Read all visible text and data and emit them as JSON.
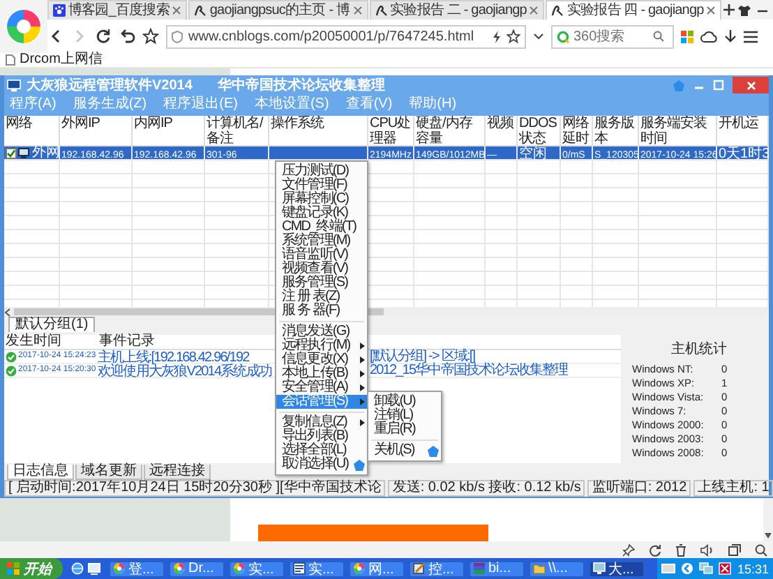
{
  "browser": {
    "tabs": [
      {
        "kind": "paw",
        "label": "博客园_百度搜索",
        "selected": false
      },
      {
        "kind": "blog",
        "label": "gaojiangpsuc的主页 - 博",
        "selected": false
      },
      {
        "kind": "blog",
        "label": "实验报告 二 - gaojiangp",
        "selected": false
      },
      {
        "kind": "blog",
        "label": "实验报告 四 - gaojiangp",
        "selected": true
      }
    ],
    "nav": [
      {
        "kind": "back",
        "disabled": false
      },
      {
        "kind": "forward",
        "disabled": true
      },
      {
        "kind": "reload",
        "disabled": false
      },
      {
        "kind": "undo",
        "disabled": false
      },
      {
        "kind": "star",
        "disabled": false
      }
    ],
    "address": "www.cnblogs.com/p20050001/p/7647245.html",
    "search": {
      "placeholder": "360搜索"
    },
    "bookmarks": [
      "Drcom上网信"
    ]
  },
  "app": {
    "title": "大灰狼远程管理软件V2014",
    "subtitle": "华中帝国技术论坛收集整理",
    "menu": [
      "程序(A)",
      "服务生成(Z)",
      "程序退出(E)",
      "本地设置(S)",
      "查看(V)",
      "帮助(H)"
    ],
    "table": {
      "columns": [
        "网络",
        "外网IP",
        "内网IP",
        "计算机名/备注",
        "操作系统",
        "CPU处理器",
        "硬盘/内存容量",
        "视频",
        "DDOS状态",
        "网络延时",
        "服务版本",
        "服务端安装时间",
        "开机运"
      ],
      "rows": [
        {
          "selected": true,
          "checked": true,
          "cells": [
            "外网",
            "192.168.42.96",
            "192.168.42.96",
            "301-96",
            null,
            "2194MHz",
            "149GB/1012MB",
            "—",
            "空闲",
            "0/mS",
            "S_120305",
            "2017-10-24 15:26",
            "0天1时3"
          ]
        }
      ]
    },
    "group_tabs": [
      {
        "label": "默认分组(1)",
        "selected": true
      }
    ],
    "log": {
      "columns": [
        "发生时间",
        "事件记录"
      ],
      "rows": [
        {
          "kind": "success",
          "time": "2017-10-24 15:24:23",
          "event_start": "主机上线:[192.168.42.96/192",
          "event_end": "[默认分组] -> 区域:[]"
        },
        {
          "kind": "success",
          "time": "2017-10-24 15:20:30",
          "event_start": "欢迎使用大灰狼V2014系统成功",
          "event_end": "2012_15华中帝国技术论坛收集整理"
        }
      ]
    },
    "stats": {
      "title": "主机统计",
      "rows": [
        {
          "label": "Windows NT:",
          "value": "0"
        },
        {
          "label": "Windows XP:",
          "value": "1"
        },
        {
          "label": "Windows Vista:",
          "value": "0"
        },
        {
          "label": "Windows 7:",
          "value": "0"
        },
        {
          "label": "Windows 2000:",
          "value": "0"
        },
        {
          "label": "Windows 2003:",
          "value": "0"
        },
        {
          "label": "Windows 2008:",
          "value": "0"
        }
      ]
    },
    "bottom_tabs": [
      {
        "label": "日志信息",
        "selected": true
      },
      {
        "label": "域名更新",
        "selected": false
      },
      {
        "label": "远程连接",
        "selected": false
      }
    ],
    "status": [
      "[ 启动时间:2017年10月24日 15时20分30秒 ][华中帝国技术论",
      "发送: 0.02 kb/s 接收: 0.12 kb/s",
      "监听端口: 2012",
      "上线主机: 1"
    ]
  },
  "context_menu": {
    "items": [
      {
        "kind": "item",
        "label": "压力测试(D)",
        "submenu": false,
        "selected": false,
        "badge": false
      },
      {
        "kind": "item",
        "label": "文件管理(F)",
        "submenu": false,
        "selected": false,
        "badge": false
      },
      {
        "kind": "item",
        "label": "屏幕控制(C)",
        "submenu": false,
        "selected": false,
        "badge": false
      },
      {
        "kind": "item",
        "label": "键盘记录(K)",
        "submenu": false,
        "selected": false,
        "badge": false
      },
      {
        "kind": "item",
        "label": "CMD_终端(T)",
        "submenu": false,
        "selected": false,
        "badge": false
      },
      {
        "kind": "item",
        "label": "系统管理(M)",
        "submenu": false,
        "selected": false,
        "badge": false
      },
      {
        "kind": "item",
        "label": "语音监听(V)",
        "submenu": false,
        "selected": false,
        "badge": false
      },
      {
        "kind": "item",
        "label": "视频查看(V)",
        "submenu": false,
        "selected": false,
        "badge": false
      },
      {
        "kind": "item",
        "label": "服务管理(S)",
        "submenu": false,
        "selected": false,
        "badge": false
      },
      {
        "kind": "item",
        "label": "注 册 表(Z)",
        "submenu": false,
        "selected": false,
        "badge": false
      },
      {
        "kind": "item",
        "label": "服 务 器(F)",
        "submenu": false,
        "selected": false,
        "badge": false
      },
      {
        "kind": "separator"
      },
      {
        "kind": "item",
        "label": "消息发送(G)",
        "submenu": false,
        "selected": false,
        "badge": false
      },
      {
        "kind": "item",
        "label": "远程执行(M)",
        "submenu": true,
        "selected": false,
        "badge": false
      },
      {
        "kind": "item",
        "label": "信息更改(X)",
        "submenu": true,
        "selected": false,
        "badge": false
      },
      {
        "kind": "item",
        "label": "本地上传(B)",
        "submenu": true,
        "selected": false,
        "badge": false
      },
      {
        "kind": "item",
        "label": "安全管理(A)",
        "submenu": true,
        "selected": false,
        "badge": false
      },
      {
        "kind": "item",
        "label": "会话管理(S)",
        "submenu": true,
        "selected": true,
        "badge": false
      },
      {
        "kind": "separator"
      },
      {
        "kind": "item",
        "label": "复制信息(Z)",
        "submenu": true,
        "selected": false,
        "badge": false
      },
      {
        "kind": "item",
        "label": "导出列表(B)",
        "submenu": false,
        "selected": false,
        "badge": false
      },
      {
        "kind": "item",
        "label": "选择全部(L)",
        "submenu": false,
        "selected": false,
        "badge": false
      },
      {
        "kind": "item",
        "label": "取消选择(U)",
        "submenu": false,
        "selected": false,
        "badge": true
      }
    ]
  },
  "submenu": {
    "items": [
      {
        "kind": "item",
        "label": "卸载(U)",
        "badge": false
      },
      {
        "kind": "item",
        "label": "注销(L)",
        "badge": false
      },
      {
        "kind": "item",
        "label": "重启(R)",
        "badge": false
      },
      {
        "kind": "separator"
      },
      {
        "kind": "item",
        "label": "关机(S)",
        "badge": true
      }
    ]
  },
  "taskbar": {
    "start": "开始",
    "buttons": [
      {
        "kind": "browser",
        "label": "登...",
        "selected": false
      },
      {
        "kind": "browser",
        "label": "Dr...",
        "selected": false
      },
      {
        "kind": "browser",
        "label": "实...",
        "selected": false
      },
      {
        "kind": "document",
        "label": "实...",
        "selected": false
      },
      {
        "kind": "browser",
        "label": "网...",
        "selected": false
      },
      {
        "kind": "tool",
        "label": "控...",
        "selected": false
      },
      {
        "kind": "archive",
        "label": "bi...",
        "selected": false
      },
      {
        "kind": "folder",
        "label": "\\\\...",
        "selected": false
      },
      {
        "kind": "monitor",
        "label": "大...",
        "selected": true
      }
    ],
    "clock": "15:31"
  }
}
